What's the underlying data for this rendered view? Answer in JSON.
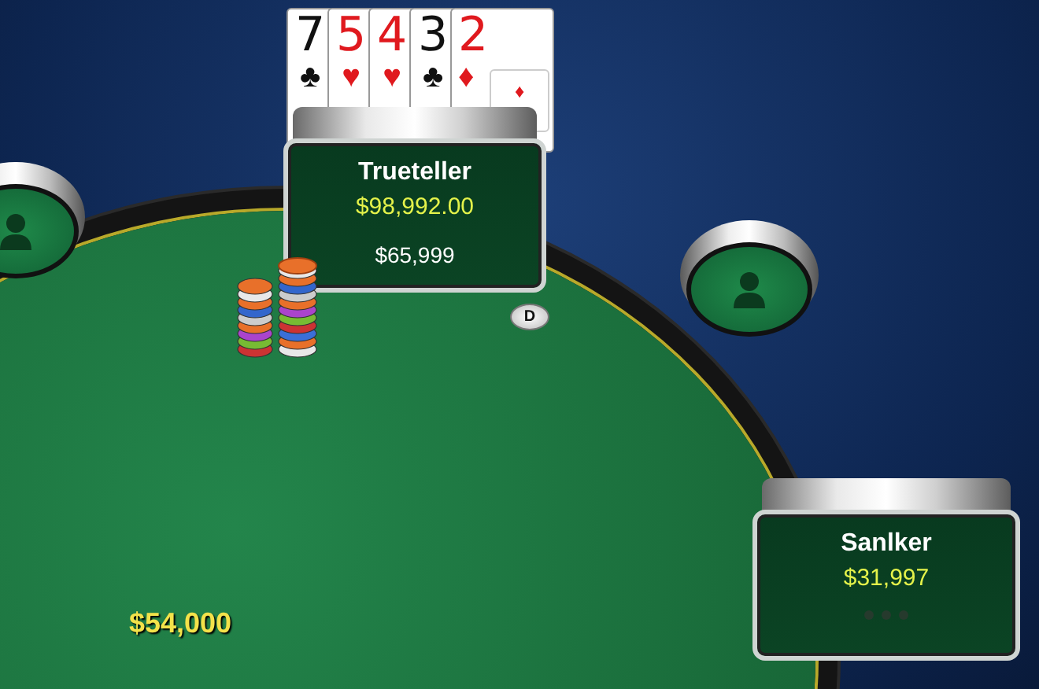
{
  "seats": [
    {
      "kind": "empty"
    },
    {
      "kind": "player",
      "name": "Trueteller",
      "stack": "$98,992.00",
      "bet": "$65,999",
      "dealer": true,
      "thinking": false,
      "cards": [
        {
          "rank": "7",
          "suit": "♣",
          "color": "#111111"
        },
        {
          "rank": "5",
          "suit": "♥",
          "color": "#e0191e"
        },
        {
          "rank": "4",
          "suit": "♥",
          "color": "#e0191e"
        },
        {
          "rank": "3",
          "suit": "♣",
          "color": "#111111"
        },
        {
          "rank": "2",
          "suit": "♦",
          "color": "#e0191e",
          "pip": "♦"
        }
      ]
    },
    {
      "kind": "empty"
    },
    {
      "kind": "player",
      "name": "Sanlker",
      "stack": "$31,997",
      "dealer": false,
      "thinking": true
    }
  ],
  "dealer_button": {
    "label": "D"
  },
  "pot": "$54,000"
}
